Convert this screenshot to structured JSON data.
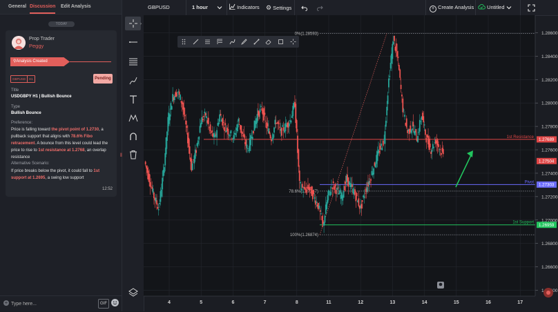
{
  "left_panel": {
    "tabs": [
      "General",
      "Discussion",
      "Edit Analysis"
    ],
    "today_label": "TODAY",
    "card": {
      "author_role": "Prop Trader",
      "author_name": "Peggy",
      "status_banner": "Analysis Created",
      "tags": [
        "GBPUSD",
        "H1"
      ],
      "pending_label": "Pending",
      "title_label": "Title",
      "title_value": "USDGBPY H1 | Bullish Bounce",
      "type_label": "Type",
      "type_value": "Bullish Bounce",
      "preference_label": "Preference:",
      "preference_parts": [
        {
          "text": "Price is falling toward ",
          "hl": false
        },
        {
          "text": "the pivot point of 1.2730",
          "hl": true
        },
        {
          "text": ", a pullback support that aligns with ",
          "hl": false
        },
        {
          "text": "78.6% Fibo retracement",
          "hl": true
        },
        {
          "text": ". A bounce from this level could lead the price to rise to ",
          "hl": false
        },
        {
          "text": "1st resistance at 1.2768",
          "hl": true
        },
        {
          "text": ", an overlap resistance",
          "hl": false
        }
      ],
      "alt_label": "Alternative Scenario:",
      "alt_parts": [
        {
          "text": "If price breaks below the pivot, it could fall to ",
          "hl": false
        },
        {
          "text": "1st support at 1.2695",
          "hl": true
        },
        {
          "text": ", a swing low support",
          "hl": false
        }
      ],
      "time": "12:52"
    },
    "message_placeholder": "Type here...",
    "gif_label": "GIF"
  },
  "top_bar": {
    "symbol": "GBPUSD",
    "timeframe": "1 hour",
    "indicators_label": "Indicators",
    "settings_label": "Settings",
    "create_analysis_label": "Create Analysis",
    "layout_name": "Untitled"
  },
  "tools": [
    "crosshair-icon",
    "horizontal-line-icon",
    "fib-tool-icon",
    "brush-icon",
    "text-icon",
    "pattern-icon",
    "magnet-icon",
    "trash-icon",
    "layers-icon"
  ],
  "colors": {
    "accent": "#e25f5b",
    "up_candle": "#26a69a",
    "down_candle": "#ef5350",
    "resistance": "#e04646",
    "pivot": "#6b6bff",
    "support": "#22c55e",
    "current_price_bg": "#e04646"
  },
  "chart_data": {
    "type": "candlestick",
    "symbol": "GBPUSD",
    "timeframe": "1 hour",
    "x_ticks": [
      "4",
      "5",
      "6",
      "7",
      "8",
      "11",
      "12",
      "13",
      "14",
      "15",
      "16",
      "17"
    ],
    "y_ticks": [
      "1.28600",
      "1.28400",
      "1.28200",
      "1.28000",
      "1.27800",
      "1.27600",
      "1.27400",
      "1.27200",
      "1.27000",
      "1.26800",
      "1.26600",
      "1.26400"
    ],
    "ylim": [
      1.2635,
      1.2875
    ],
    "grid": true,
    "levels": [
      {
        "label": "1st Resistance",
        "price": 1.27689,
        "price_label": "1.27689",
        "color": "#e04646"
      },
      {
        "label": "Pivot",
        "price": 1.27303,
        "price_label": "1.27303",
        "color": "#6b6bff"
      },
      {
        "label": "1st Support",
        "price": 1.26959,
        "price_label": "1.26959",
        "color": "#22c55e"
      }
    ],
    "current_price": {
      "price": 1.27504,
      "label": "1.27504"
    },
    "fibonacci": [
      {
        "label": "0%(1.28593)",
        "price": 1.28593
      },
      {
        "label": "78.6%(1.27247)",
        "price": 1.27247
      },
      {
        "label": "100%(1.26874)",
        "price": 1.26874
      }
    ],
    "price_path": [
      [
        0.0,
        1.275
      ],
      [
        0.25,
        1.2735
      ],
      [
        0.5,
        1.272
      ],
      [
        0.75,
        1.271
      ],
      [
        1.0,
        1.274
      ],
      [
        1.25,
        1.2785
      ],
      [
        1.5,
        1.2805
      ],
      [
        1.75,
        1.281
      ],
      [
        2.0,
        1.28
      ],
      [
        2.25,
        1.2775
      ],
      [
        2.5,
        1.2745
      ],
      [
        2.75,
        1.276
      ],
      [
        3.0,
        1.2785
      ],
      [
        3.25,
        1.279
      ],
      [
        3.5,
        1.2775
      ],
      [
        3.75,
        1.277
      ],
      [
        4.0,
        1.279
      ],
      [
        4.25,
        1.278
      ],
      [
        4.5,
        1.2775
      ],
      [
        4.75,
        1.277
      ],
      [
        5.0,
        1.2785
      ],
      [
        5.25,
        1.277
      ],
      [
        5.5,
        1.276
      ],
      [
        5.75,
        1.2775
      ],
      [
        6.0,
        1.279
      ],
      [
        6.25,
        1.2795
      ],
      [
        6.5,
        1.278
      ],
      [
        6.75,
        1.277
      ],
      [
        7.0,
        1.2785
      ],
      [
        7.25,
        1.2775
      ],
      [
        7.5,
        1.278
      ],
      [
        7.75,
        1.2785
      ],
      [
        8.0,
        1.28
      ],
      [
        8.25,
        1.273
      ],
      [
        8.5,
        1.2725
      ],
      [
        8.75,
        1.2728
      ],
      [
        9.0,
        1.272
      ],
      [
        9.25,
        1.2712
      ],
      [
        9.5,
        1.2695
      ],
      [
        9.75,
        1.272
      ],
      [
        10.0,
        1.273
      ],
      [
        10.25,
        1.2725
      ],
      [
        10.5,
        1.272
      ],
      [
        10.75,
        1.2735
      ],
      [
        11.0,
        1.2728
      ],
      [
        11.25,
        1.272
      ],
      [
        11.5,
        1.271
      ],
      [
        11.75,
        1.2725
      ],
      [
        12.0,
        1.2735
      ],
      [
        12.25,
        1.2748
      ],
      [
        12.5,
        1.276
      ],
      [
        12.75,
        1.2768
      ],
      [
        13.0,
        1.282
      ],
      [
        13.25,
        1.2855
      ],
      [
        13.5,
        1.2835
      ],
      [
        13.75,
        1.2795
      ],
      [
        14.0,
        1.2775
      ],
      [
        14.25,
        1.278
      ],
      [
        14.5,
        1.277
      ],
      [
        14.75,
        1.279
      ],
      [
        15.0,
        1.277
      ],
      [
        15.25,
        1.276
      ],
      [
        15.5,
        1.2768
      ],
      [
        15.75,
        1.276
      ],
      [
        16.0,
        1.2752
      ],
      [
        16.25,
        1.2755
      ],
      [
        16.5,
        1.275
      ]
    ]
  }
}
